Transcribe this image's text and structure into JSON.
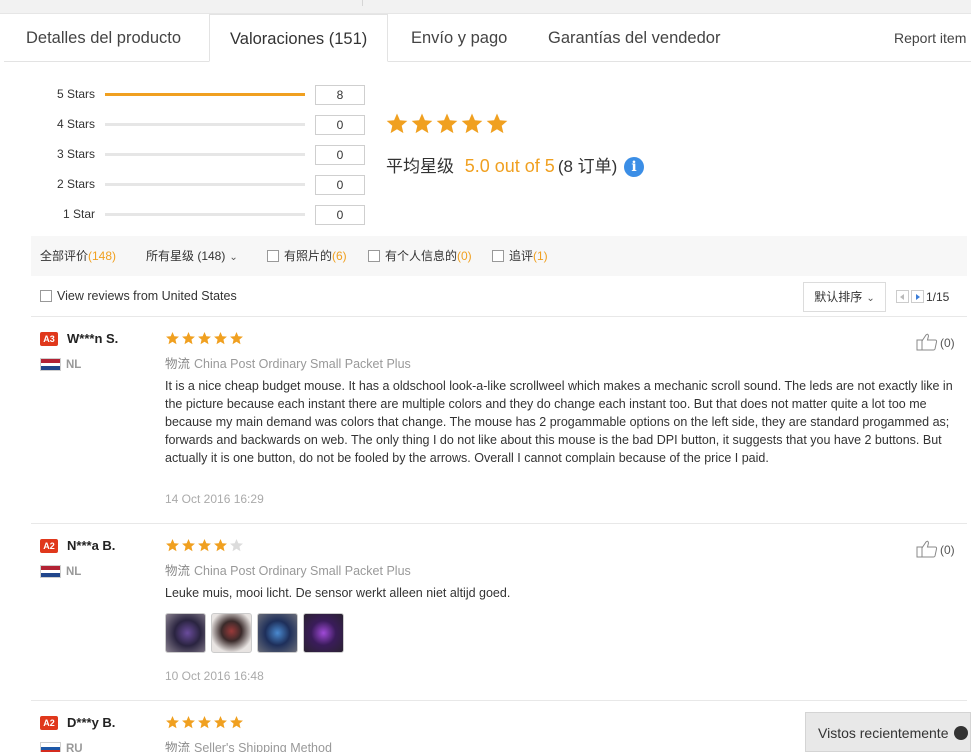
{
  "tabs": [
    {
      "label": "Detalles del producto"
    },
    {
      "label": "Valoraciones (151)"
    },
    {
      "label": "Envío y pago"
    },
    {
      "label": "Garantías del vendedor"
    },
    {
      "label": "Report item"
    }
  ],
  "rating_summary": {
    "bars": [
      {
        "label": "5 Stars",
        "count": "8",
        "fraction": 1.0
      },
      {
        "label": "4 Stars",
        "count": "0",
        "fraction": 0
      },
      {
        "label": "3 Stars",
        "count": "0",
        "fraction": 0
      },
      {
        "label": "2 Stars",
        "count": "0",
        "fraction": 0
      },
      {
        "label": "1 Star",
        "count": "0",
        "fraction": 0
      }
    ],
    "big_stars": 5,
    "avg_prefix": "平均星级",
    "avg_score": "5.0 out of 5",
    "avg_orders": "(8 订单)",
    "info_icon": "i"
  },
  "filters": {
    "all_label": "全部评价",
    "all_count": "(148)",
    "stars_label": "所有星级 (148)",
    "photos_label": "有照片的",
    "photos_count": "(6)",
    "personal_label": "有个人信息的",
    "personal_count": "(0)",
    "followup_label": "追评",
    "followup_count": "(1)"
  },
  "view_us_label": "View reviews from United States",
  "sort_label": "默认排序",
  "pager_text": "1/15",
  "reviews": [
    {
      "level": "A3",
      "name": "W***n S.",
      "country": "NL",
      "rating": 5,
      "logistics_label": "物流",
      "logistics": "China Post Ordinary Small Packet Plus",
      "text": "It is a nice cheap budget mouse. It has a oldschool look-a-like scrollweel which makes a mechanic scroll sound. The leds are not exactly like in the picture because each instant there are multiple colors and they do change each instant too. But that does not matter quite a lot too me because my main demand was colors that change. The mouse has 2 progammable options on the left side, they are standard progammed as; forwards and backwards on web. The only thing I do not like about this mouse is the bad DPI button, it suggests that you have 2 buttons. But actually it is one button, do not be fooled by the arrows. Overall I cannot complain because of the price I paid.",
      "date": "14 Oct 2016 16:29",
      "helpful": "(0)"
    },
    {
      "level": "A2",
      "name": "N***a B.",
      "country": "NL",
      "rating": 4,
      "logistics_label": "物流",
      "logistics": "China Post Ordinary Small Packet Plus",
      "text": "Leuke muis, mooi licht. De sensor werkt alleen niet altijd goed.",
      "date": "10 Oct 2016 16:48",
      "helpful": "(0)"
    },
    {
      "level": "A2",
      "name": "D***y B.",
      "country": "RU",
      "rating": 5,
      "logistics_label": "物流",
      "logistics": "Seller's Shipping Method"
    }
  ],
  "recent_label": "Vistos recientemente",
  "colors": {
    "accent": "#f0a020",
    "badge": "#e0381c",
    "info": "#3b8ee6"
  }
}
